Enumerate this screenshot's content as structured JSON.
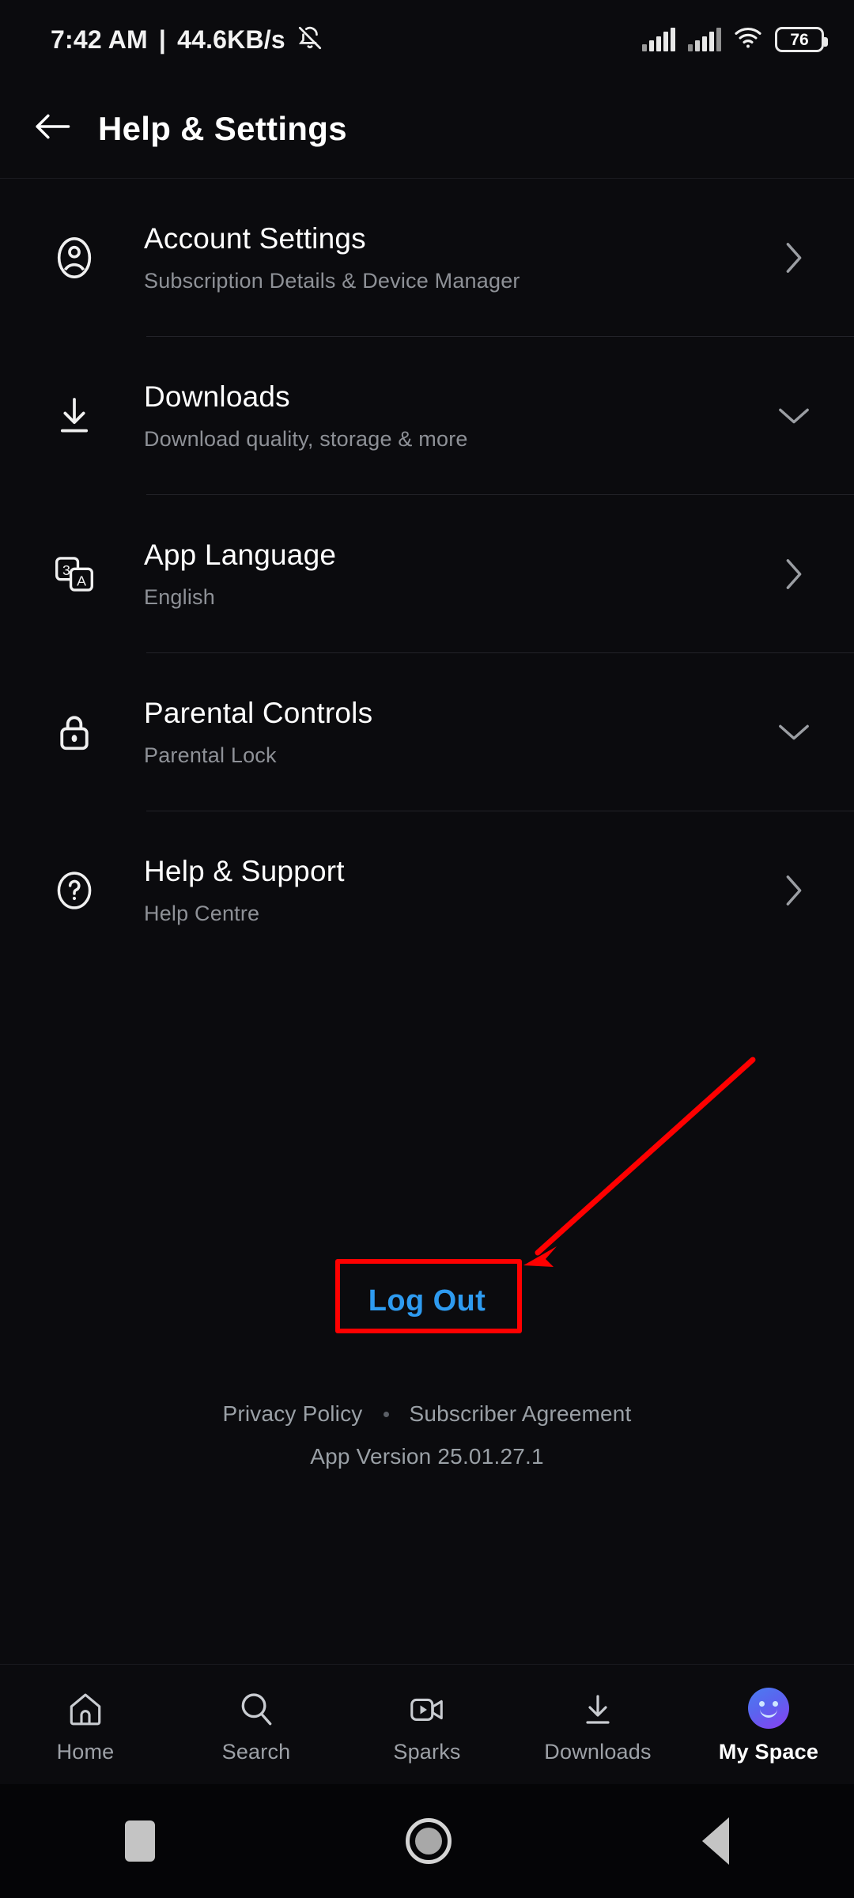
{
  "status_bar": {
    "time": "7:42 AM",
    "separator": "|",
    "network_speed": "44.6KB/s",
    "ring_icon": "bell-mute-icon",
    "signal_icon_1": "signal-bars-icon",
    "signal_icon_2": "signal-bars-icon",
    "wifi_icon": "wifi-icon",
    "battery_level": "76"
  },
  "app_bar": {
    "back_icon": "back-arrow-icon",
    "title": "Help & Settings"
  },
  "settings": {
    "items": [
      {
        "icon": "account-circle-icon",
        "title": "Account Settings",
        "subtitle": "Subscription Details & Device Manager",
        "chevron": "chevron-right-icon"
      },
      {
        "icon": "download-icon",
        "title": "Downloads",
        "subtitle": "Download quality, storage & more",
        "chevron": "chevron-down-icon"
      },
      {
        "icon": "translate-icon",
        "title": "App Language",
        "subtitle": "English",
        "chevron": "chevron-right-icon"
      },
      {
        "icon": "lock-icon",
        "title": "Parental Controls",
        "subtitle": "Parental Lock",
        "chevron": "chevron-down-icon"
      },
      {
        "icon": "help-circle-icon",
        "title": "Help & Support",
        "subtitle": "Help Centre",
        "chevron": "chevron-right-icon"
      }
    ]
  },
  "logout": {
    "label": "Log Out",
    "color": "#2e9bf0"
  },
  "annotation": {
    "highlight_color": "#ff0000",
    "target": "Log Out",
    "arrow_icon": "red-arrow-icon"
  },
  "footer": {
    "privacy_policy": "Privacy Policy",
    "subscriber_agreement": "Subscriber Agreement",
    "app_version": "App Version 25.01.27.1"
  },
  "bottom_nav": {
    "items": [
      {
        "icon": "home-icon",
        "label": "Home",
        "active": false
      },
      {
        "icon": "search-icon",
        "label": "Search",
        "active": false
      },
      {
        "icon": "video-camera-icon",
        "label": "Sparks",
        "active": false
      },
      {
        "icon": "download-icon",
        "label": "Downloads",
        "active": false
      },
      {
        "icon": "avatar-icon",
        "label": "My Space",
        "active": true
      }
    ]
  },
  "android_nav": {
    "recents_icon": "recents-square-icon",
    "home_icon": "home-circle-icon",
    "back_icon": "back-triangle-icon"
  }
}
